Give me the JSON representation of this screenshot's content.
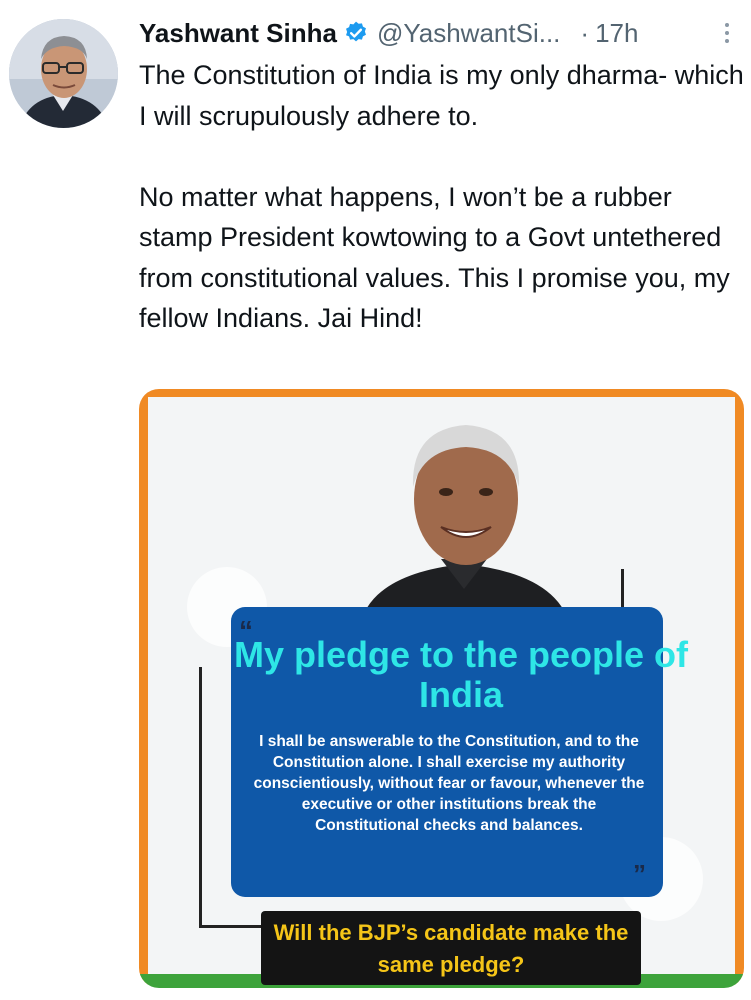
{
  "tweet": {
    "display_name": "Yashwant Sinha",
    "handle": "@YashwantSi...",
    "separator": "·",
    "time": "17h",
    "text": "The Constitution of India is my only dharma- which I will scrupulously adhere to.\n\nNo matter what happens, I won’t be a rubber stamp President kowtowing to a Govt untethered from constitutional values. This I promise you, my fellow Indians. Jai Hind!"
  },
  "media": {
    "title": "My pledge to the people of India",
    "body": "I shall be answerable to the Constitution, and to the Constitution alone. I shall exercise my authority conscientiously, without fear or favour, whenever the executive or other institutions break the Constitutional checks and balances.",
    "question": "Will the BJP’s candidate make the same pledge?",
    "quote_open": "“",
    "quote_close": "”"
  },
  "colors": {
    "verified_blue": "#1d9bf0",
    "pledge_blue": "#0f58a8",
    "title_cyan": "#2ee6e6",
    "saffron": "#f08a24",
    "green": "#3da33b",
    "question_yellow": "#f5c518"
  },
  "icons": {
    "verified": "verified-badge-icon",
    "more": "more-options-icon"
  }
}
